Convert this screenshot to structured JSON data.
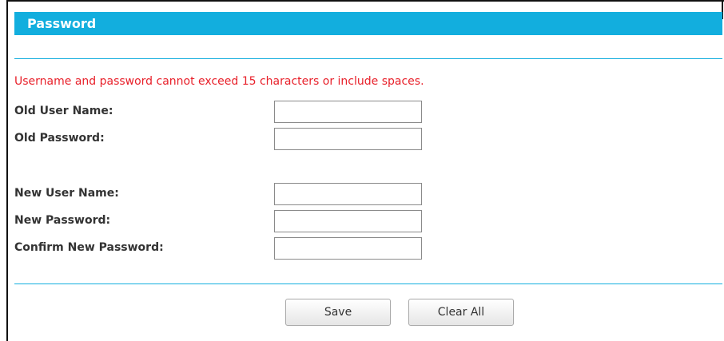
{
  "header": {
    "title": "Password"
  },
  "notice": "Username and password cannot exceed 15 characters or include spaces.",
  "fields": {
    "old_user_name": {
      "label": "Old User Name:",
      "value": ""
    },
    "old_password": {
      "label": "Old Password:",
      "value": ""
    },
    "new_user_name": {
      "label": "New User Name:",
      "value": ""
    },
    "new_password": {
      "label": "New Password:",
      "value": ""
    },
    "confirm_new_password": {
      "label": "Confirm New Password:",
      "value": ""
    }
  },
  "buttons": {
    "save": "Save",
    "clear_all": "Clear All"
  },
  "colors": {
    "accent": "#12aede",
    "warning": "#e8202a"
  }
}
